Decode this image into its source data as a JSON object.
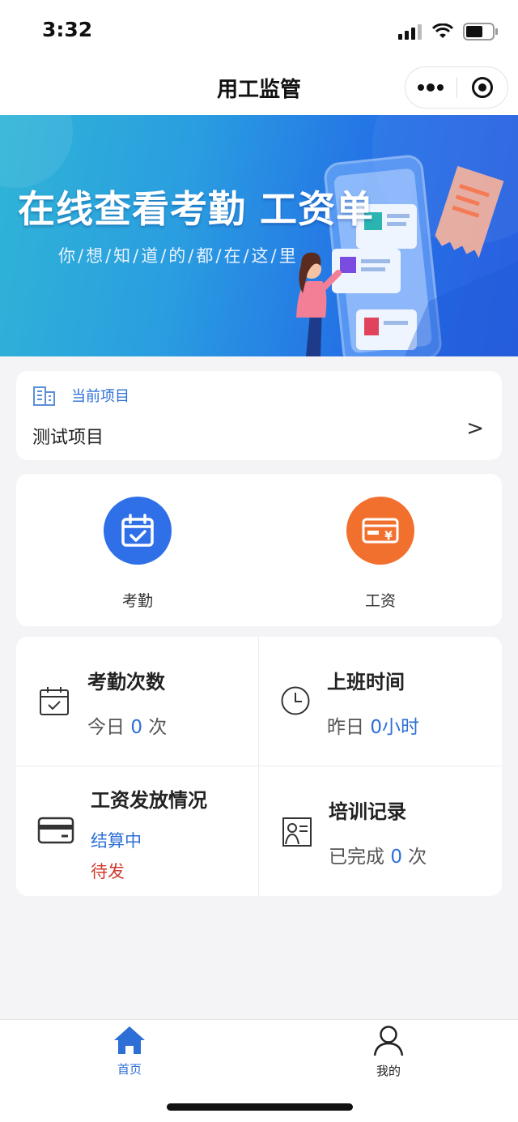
{
  "status_bar": {
    "time": "3:32"
  },
  "nav": {
    "title": "用工监管"
  },
  "banner": {
    "title": "在线查看考勤 工资单",
    "subtitle": "你/想/知/道/的/都/在/这/里"
  },
  "project": {
    "label": "当前项目",
    "name": "测试项目",
    "arrow": ">"
  },
  "actions": [
    {
      "label": "考勤",
      "icon": "calendar-check-icon",
      "color": "#2f6fe8"
    },
    {
      "label": "工资",
      "icon": "salary-card-icon",
      "color": "#f2702e"
    }
  ],
  "stats": {
    "attendance": {
      "title": "考勤次数",
      "prefix": "今日",
      "value": "0",
      "suffix": "次"
    },
    "work_time": {
      "title": "上班时间",
      "prefix": "昨日",
      "value": "0小时"
    },
    "salary": {
      "title": "工资发放情况",
      "status1": "结算中",
      "status2": "待发"
    },
    "training": {
      "title": "培训记录",
      "prefix": "已完成",
      "value": "0",
      "suffix": "次"
    }
  },
  "tabs": [
    {
      "label": "首页",
      "icon": "home-icon",
      "active": true,
      "color": "#2d6fd6"
    },
    {
      "label": "我的",
      "icon": "user-icon",
      "active": false,
      "color": "#222222"
    }
  ]
}
